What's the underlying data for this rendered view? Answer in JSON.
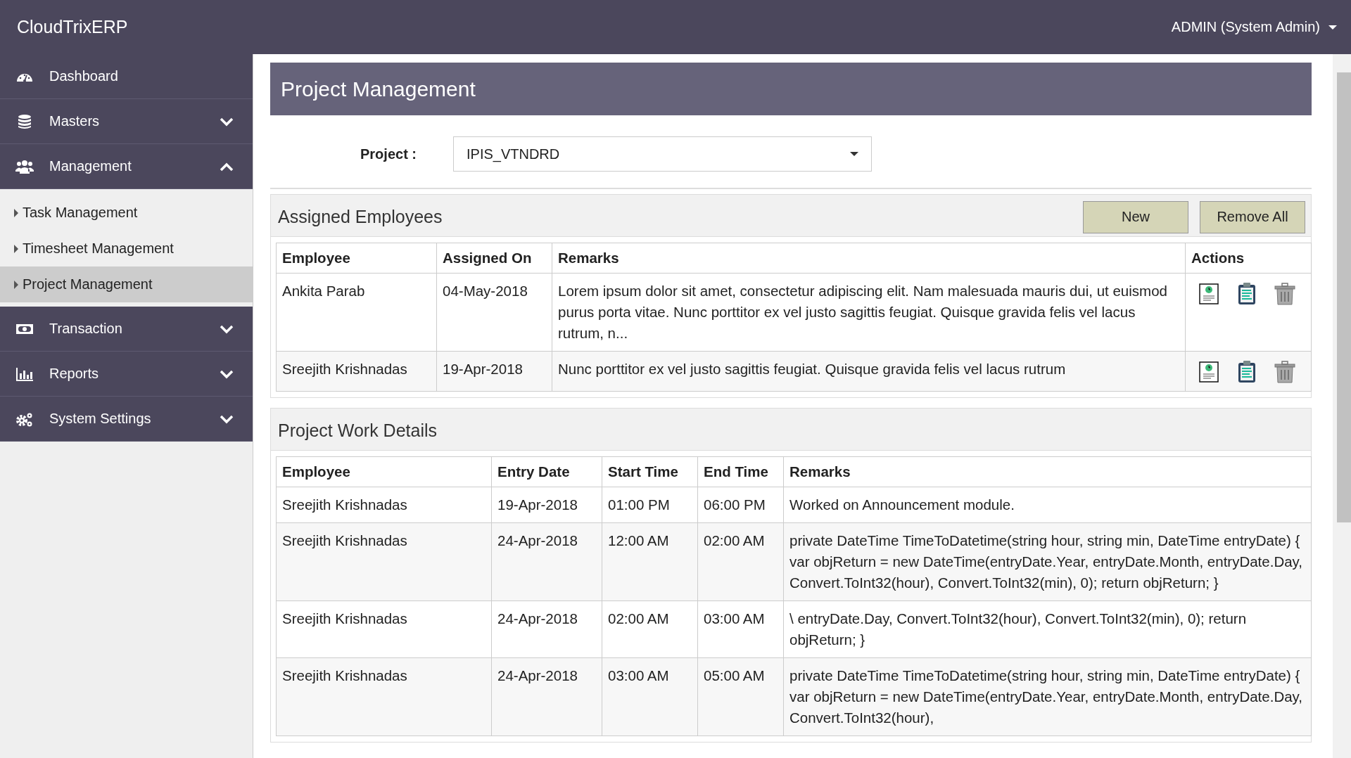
{
  "app": {
    "title": "CloudTrixERP",
    "user_menu": "ADMIN (System Admin)"
  },
  "sidebar": {
    "items": [
      {
        "label": "Dashboard"
      },
      {
        "label": "Masters",
        "expanded": false
      },
      {
        "label": "Management",
        "expanded": true,
        "children": [
          {
            "label": "Task Management",
            "selected": false
          },
          {
            "label": "Timesheet Management",
            "selected": false
          },
          {
            "label": "Project Management",
            "selected": true
          }
        ]
      },
      {
        "label": "Transaction",
        "expanded": false
      },
      {
        "label": "Reports",
        "expanded": false
      },
      {
        "label": "System Settings",
        "expanded": false
      }
    ]
  },
  "page": {
    "title": "Project Management"
  },
  "project_field": {
    "label": "Project :",
    "value": "IPIS_VTNDRD"
  },
  "assigned": {
    "title": "Assigned Employees",
    "buttons": [
      "New",
      "Remove All"
    ],
    "columns": [
      "Employee",
      "Assigned On",
      "Remarks",
      "Actions"
    ],
    "rows": [
      {
        "employee": "Ankita Parab",
        "assigned_on": "04-May-2018",
        "remarks": "Lorem ipsum dolor sit amet, consectetur adipiscing elit. Nam malesuada mauris dui, ut euismod purus porta vitae. Nunc porttitor ex vel justo sagittis feugiat. Quisque gravida felis vel lacus rutrum, n..."
      },
      {
        "employee": "Sreejith Krishnadas",
        "assigned_on": "19-Apr-2018",
        "remarks": "Nunc porttitor ex vel justo sagittis feugiat. Quisque gravida felis vel lacus rutrum"
      }
    ]
  },
  "work": {
    "title": "Project Work Details",
    "columns": [
      "Employee",
      "Entry Date",
      "Start Time",
      "End Time",
      "Remarks"
    ],
    "rows": [
      [
        "Sreejith Krishnadas",
        "19-Apr-2018",
        "01:00 PM",
        "06:00 PM",
        "Worked on Announcement module."
      ],
      [
        "Sreejith Krishnadas",
        "24-Apr-2018",
        "12:00 AM",
        "02:00 AM",
        "private DateTime TimeToDatetime(string hour, string min, DateTime entryDate) { var objReturn = new DateTime(entryDate.Year, entryDate.Month, entryDate.Day, Convert.ToInt32(hour), Convert.ToInt32(min), 0); return objReturn; }"
      ],
      [
        "Sreejith Krishnadas",
        "24-Apr-2018",
        "02:00 AM",
        "03:00 AM",
        "\\ entryDate.Day, Convert.ToInt32(hour), Convert.ToInt32(min), 0); return objReturn; }"
      ],
      [
        "Sreejith Krishnadas",
        "24-Apr-2018",
        "03:00 AM",
        "05:00 AM",
        "private DateTime TimeToDatetime(string hour, string min, DateTime entryDate) { var objReturn = new DateTime(entryDate.Year, entryDate.Month, entryDate.Day, Convert.ToInt32(hour),"
      ]
    ]
  }
}
